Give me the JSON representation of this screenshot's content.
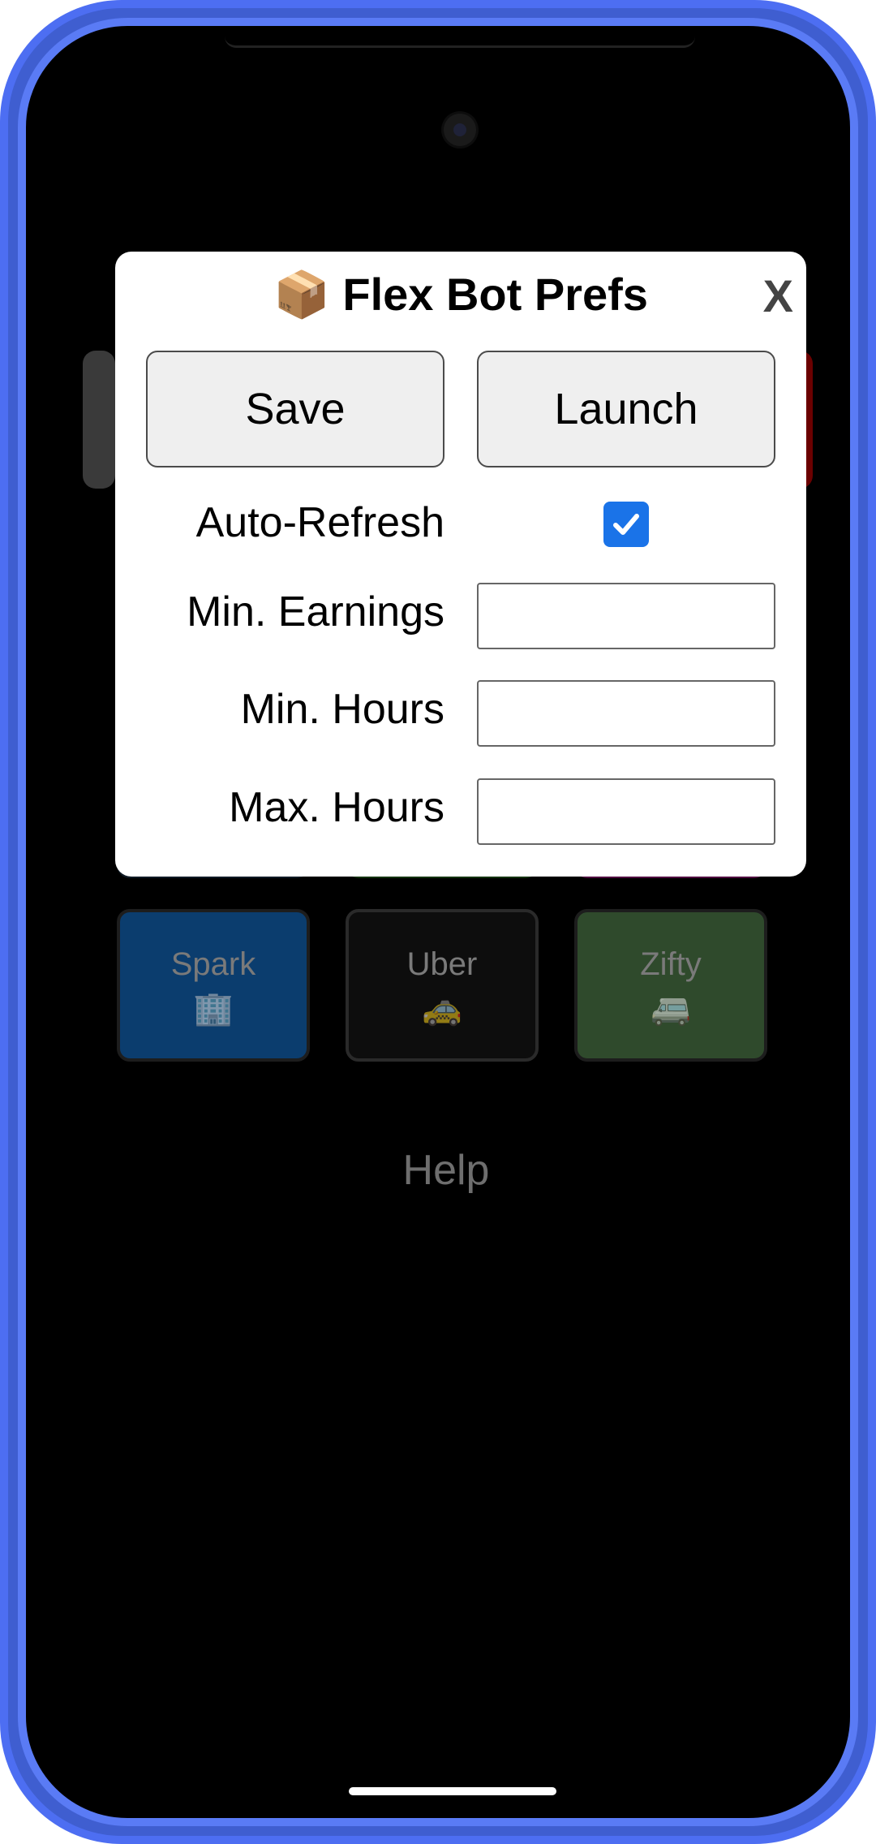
{
  "background_app": {
    "tiles": [
      {
        "label": "Spark",
        "icon": "🏢",
        "icon_name": "office-building-icon",
        "color": "#0b3d6e"
      },
      {
        "label": "Uber",
        "icon": "🚕",
        "icon_name": "taxi-icon",
        "color": "#0d0d0d"
      },
      {
        "label": "Zifty",
        "icon": "🚐",
        "icon_name": "minibus-icon",
        "color": "#2f4a2c"
      }
    ],
    "help_label": "Help"
  },
  "modal": {
    "title_icon": "📦",
    "title_icon_name": "package-icon",
    "title": "Flex Bot Prefs",
    "close_label": "X",
    "save_label": "Save",
    "launch_label": "Launch",
    "auto_refresh": {
      "label": "Auto-Refresh",
      "checked": true
    },
    "min_earnings": {
      "label": "Min. Earnings",
      "value": ""
    },
    "min_hours": {
      "label": "Min. Hours",
      "value": ""
    },
    "max_hours": {
      "label": "Max. Hours",
      "value": ""
    }
  },
  "colors": {
    "frame": "#4d6ef2",
    "checkbox": "#1a73e8"
  }
}
